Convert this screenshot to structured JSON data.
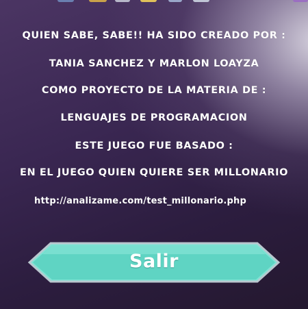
{
  "credits": {
    "line1": "QUIEN SABE, SABE!! HA SIDO CREADO POR :",
    "line2": "TANIA SANCHEZ Y MARLON LOAYZA",
    "line3": "COMO PROYECTO DE LA MATERIA DE :",
    "line4": "LENGUAJES DE PROGRAMACION",
    "line5": "ESTE JUEGO FUE BASADO :",
    "line6": "EN EL JUEGO QUIEN QUIERE SER MILLONARIO",
    "url": "http://analizame.com/test_millonario.php"
  },
  "exit_button": {
    "label": "Salir"
  },
  "colors": {
    "text": "#ffffff",
    "button_fill": "#5fd4c3",
    "button_border": "#3aa99a",
    "background_dark": "#2c1d3f"
  }
}
